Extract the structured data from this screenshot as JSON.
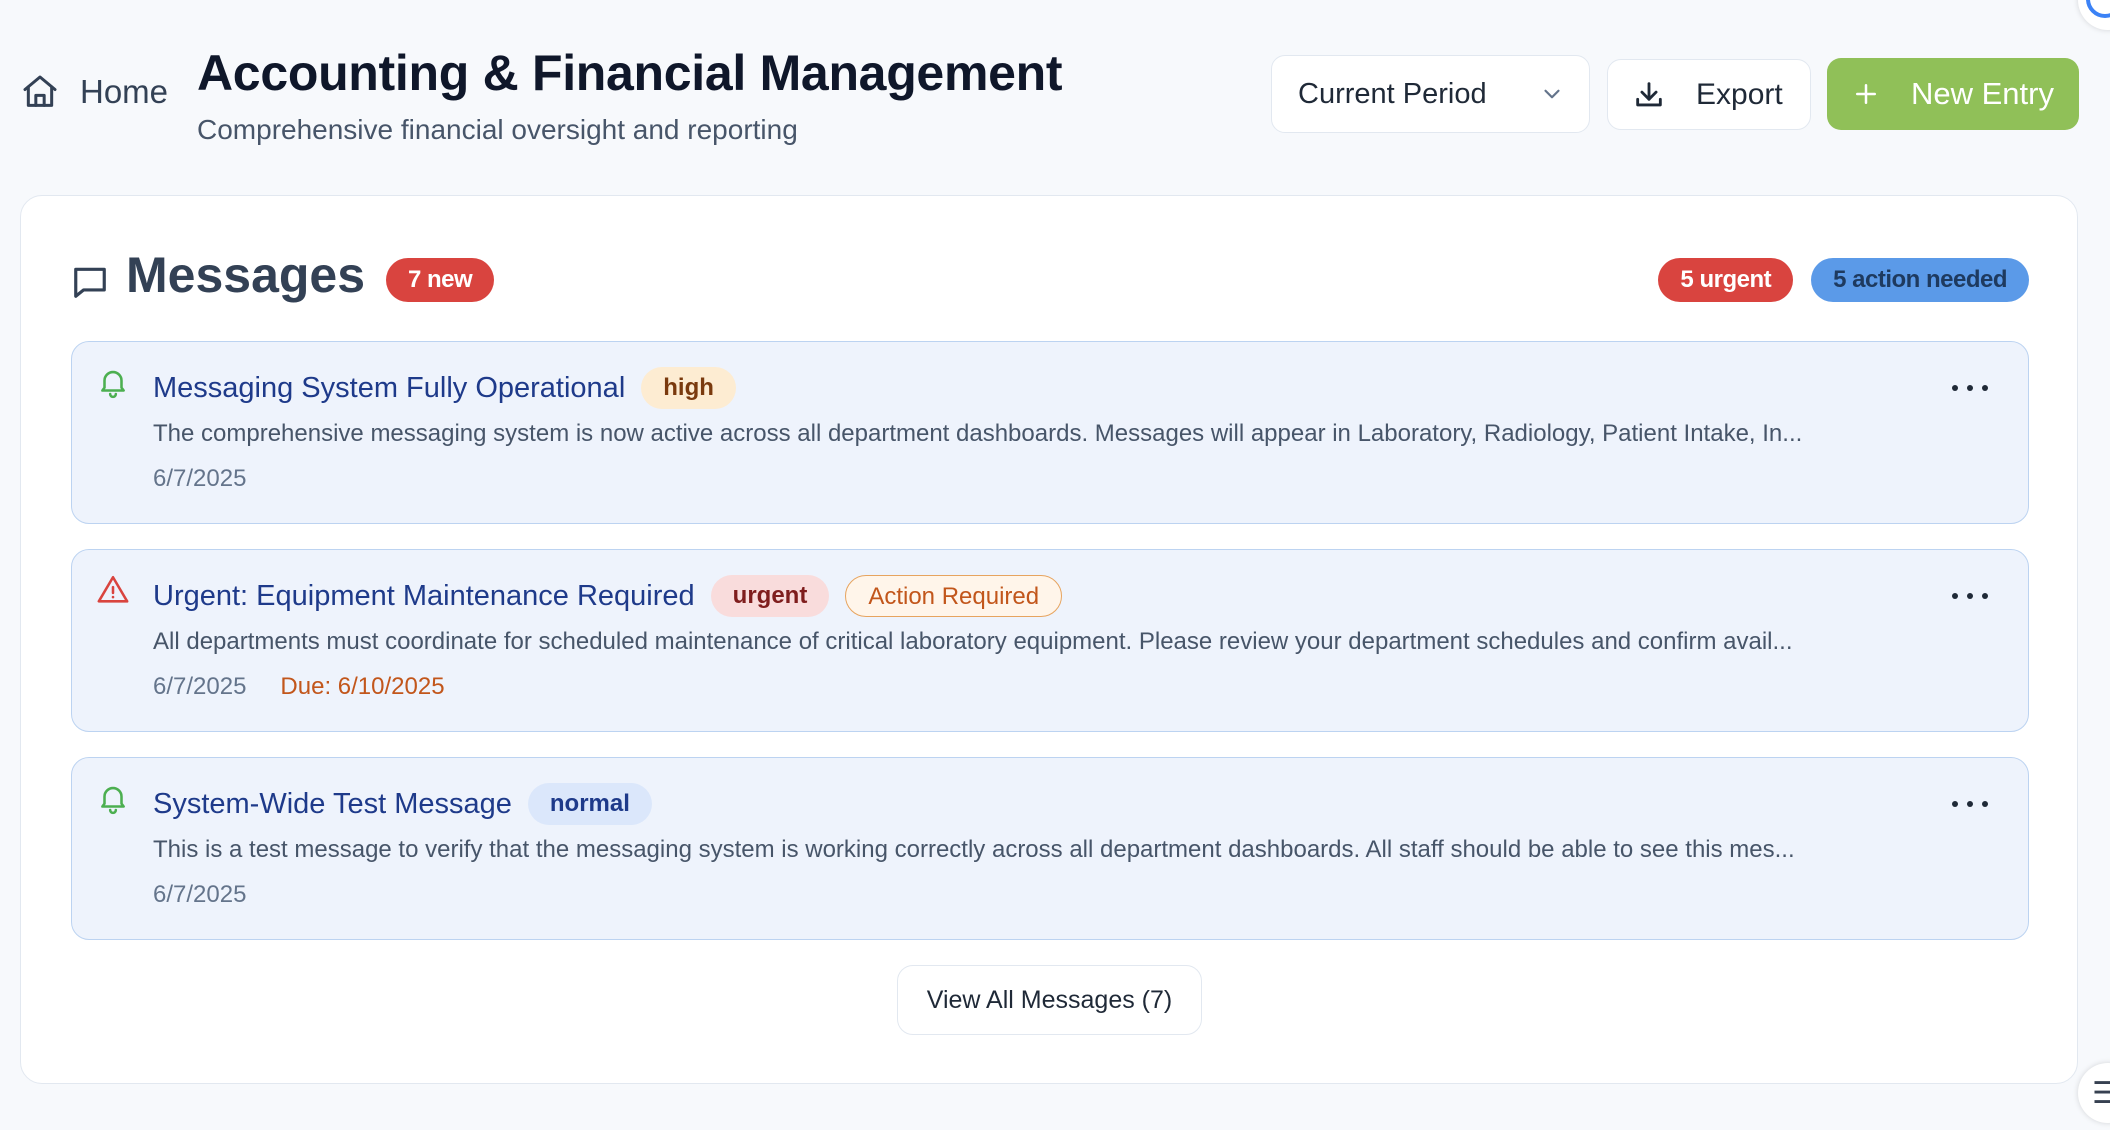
{
  "header": {
    "home_label": "Home",
    "title": "Accounting & Financial Management",
    "subtitle": "Comprehensive financial oversight and reporting",
    "period_select": {
      "selected": "Current Period",
      "icon": "chevron-down-icon"
    },
    "export_label": "Export",
    "new_entry_label": "New Entry",
    "colors": {
      "primary_button": "#90c058"
    }
  },
  "messages": {
    "title": "Messages",
    "new_badge": "7 new",
    "urgent_badge": "5 urgent",
    "action_badge": "5 action needed",
    "items": [
      {
        "icon": "bell-icon",
        "title": "Messaging System Fully Operational",
        "priority": "high",
        "body": "The comprehensive messaging system is now active across all department dashboards. Messages will appear in Laboratory, Radiology, Patient Intake, In...",
        "date": "6/7/2025"
      },
      {
        "icon": "alert-triangle-icon",
        "title": "Urgent: Equipment Maintenance Required",
        "priority": "urgent",
        "action_tag": "Action Required",
        "body": "All departments must coordinate for scheduled maintenance of critical laboratory equipment. Please review your department schedules and confirm avail...",
        "date": "6/7/2025",
        "due": "Due: 6/10/2025"
      },
      {
        "icon": "bell-icon",
        "title": "System-Wide Test Message",
        "priority": "normal",
        "body": "This is a test message to verify that the messaging system is working correctly across all department dashboards. All staff should be able to see this mes...",
        "date": "6/7/2025"
      }
    ],
    "view_all_label": "View All Messages (7)",
    "colors": {
      "urgent": "#d9443f",
      "info": "#5b9ae8",
      "item_bg": "#eef3fc"
    }
  },
  "floating_widget_glyph": "☰"
}
